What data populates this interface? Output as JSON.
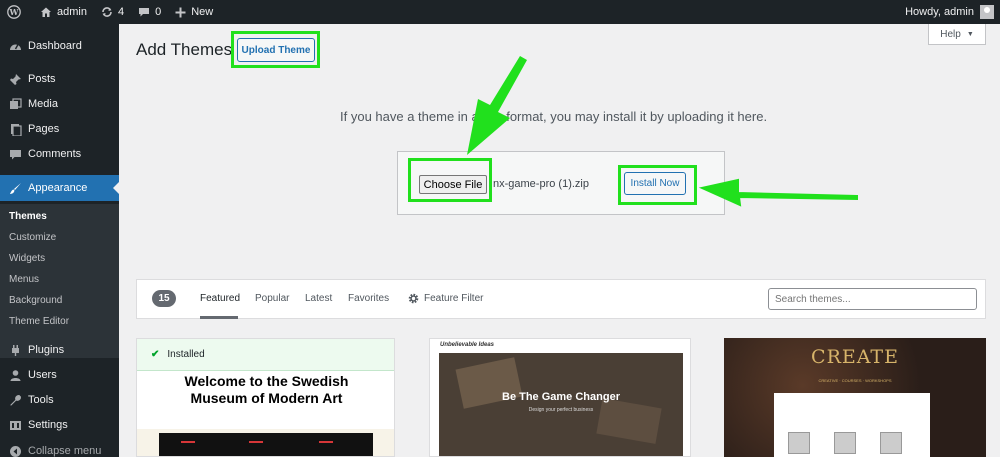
{
  "adminbar": {
    "site_name": "admin",
    "updates_count": "4",
    "comments_count": "0",
    "new_label": "New",
    "howdy": "Howdy, admin"
  },
  "sidebar": {
    "items": [
      {
        "label": "Dashboard",
        "icon": "dashboard-icon"
      },
      {
        "label": "Posts",
        "icon": "pin-icon"
      },
      {
        "label": "Media",
        "icon": "media-icon"
      },
      {
        "label": "Pages",
        "icon": "pages-icon"
      },
      {
        "label": "Comments",
        "icon": "comment-icon"
      },
      {
        "label": "Appearance",
        "icon": "brush-icon"
      },
      {
        "label": "Plugins",
        "icon": "plug-icon"
      },
      {
        "label": "Users",
        "icon": "user-icon"
      },
      {
        "label": "Tools",
        "icon": "wrench-icon"
      },
      {
        "label": "Settings",
        "icon": "settings-icon"
      },
      {
        "label": "Collapse menu",
        "icon": "collapse-icon"
      }
    ],
    "submenu": [
      "Themes",
      "Customize",
      "Widgets",
      "Menus",
      "Background",
      "Theme Editor"
    ]
  },
  "page": {
    "title": "Add Themes",
    "upload_button": "Upload Theme",
    "help": "Help",
    "upload_description": "If you have a theme in a .zip format, you may install it by uploading it here.",
    "choose_file": "Choose File",
    "file_name": "nx-game-pro (1).zip",
    "install_now": "Install Now"
  },
  "filter": {
    "count": "15",
    "tabs": [
      "Featured",
      "Popular",
      "Latest",
      "Favorites"
    ],
    "feature_filter": "Feature Filter",
    "search_placeholder": "Search themes..."
  },
  "themes": {
    "card1": {
      "status": "Installed",
      "title_line1": "Welcome to the Swedish",
      "title_line2": "Museum of Modern Art"
    },
    "card2": {
      "logo": "Unbelievable Ideas",
      "hero_title": "Be The Game Changer",
      "hero_sub": "Design your perfect business"
    },
    "card3": {
      "title": "CREATE",
      "sub": "CREATIVE · COURSES · WORKSHOPS"
    }
  },
  "colors": {
    "adminbar_bg": "#1d2327",
    "accent": "#2271b1",
    "highlight": "#21e01d",
    "installed_check": "#00a32a"
  }
}
